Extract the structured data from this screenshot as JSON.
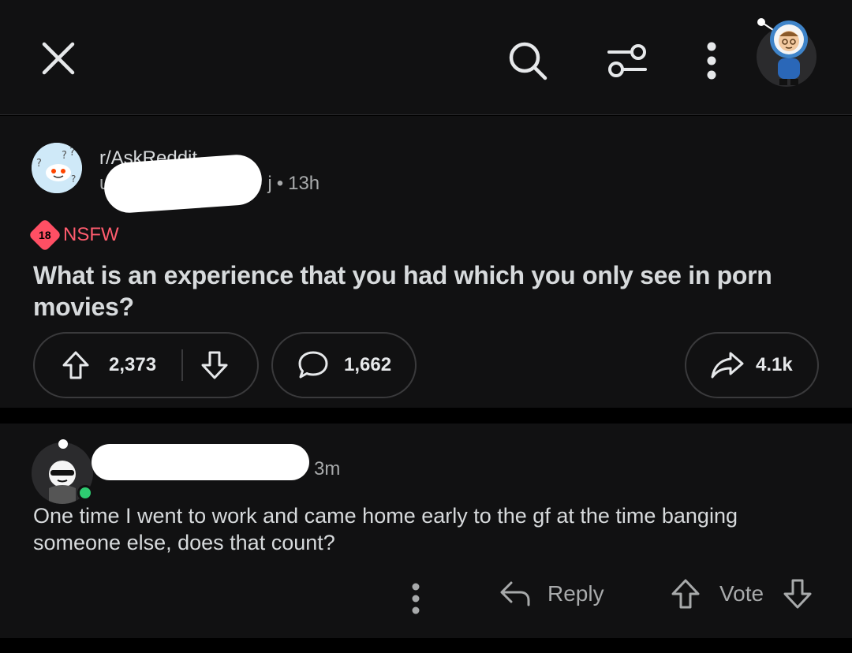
{
  "topbar": {
    "close_icon": "close-icon",
    "search_icon": "search-icon",
    "filter_icon": "sliders-icon",
    "more_icon": "more-vertical-icon"
  },
  "post": {
    "subreddit": "r/AskReddit",
    "username_partial_start": "u",
    "username_partial_end": "j",
    "separator": "•",
    "age": "13h",
    "nsfw_badge": "18",
    "nsfw_label": "NSFW",
    "title": "What is an experience that you had which you only see in porn movies?",
    "upvotes": "2,373",
    "comments": "1,662",
    "shares": "4.1k"
  },
  "comment": {
    "age": "3m",
    "body": "One time I went to work and came home early to the gf at the time banging someone else, does that count?",
    "reply_label": "Reply",
    "vote_label": "Vote"
  },
  "colors": {
    "background": "#111112",
    "nsfw": "#ff4f64",
    "online": "#2ecc71",
    "text": "#d7dadc",
    "muted": "#a8aaab"
  }
}
